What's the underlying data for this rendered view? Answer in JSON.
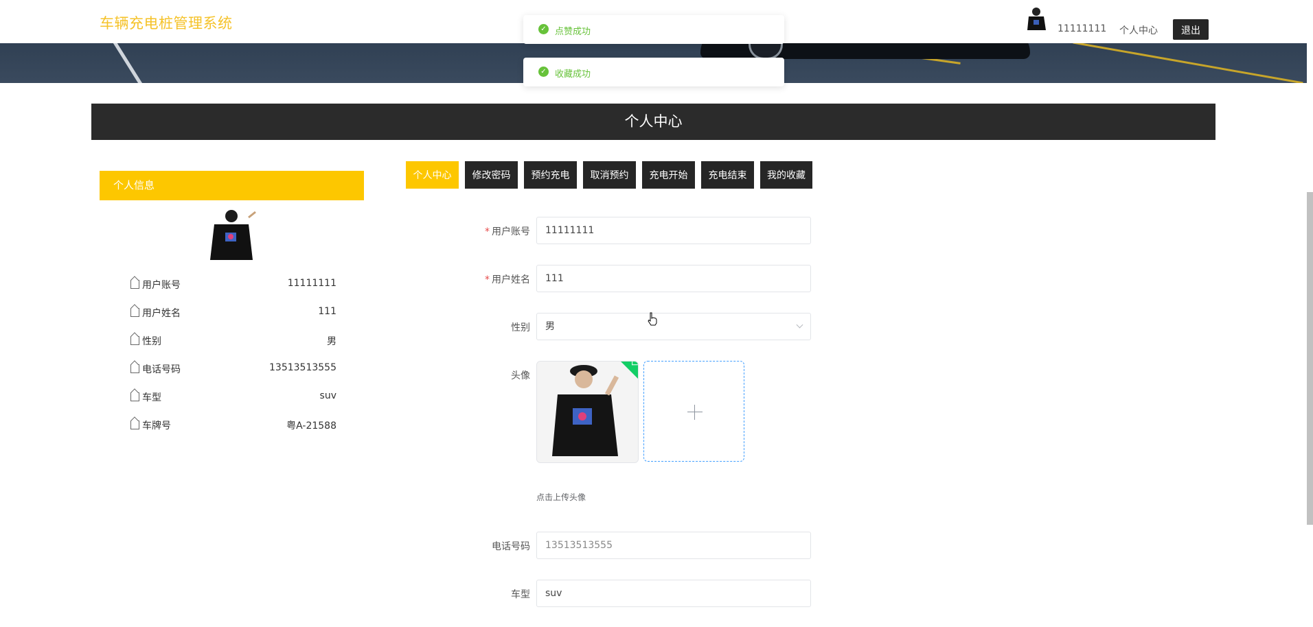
{
  "header": {
    "title": "车辆充电桩管理系统",
    "username": "11111111",
    "center_link": "个人中心",
    "logout_label": "退出"
  },
  "toasts": [
    {
      "text": "点赞成功",
      "color": "#67c23a"
    },
    {
      "text": "收藏成功",
      "color": "#67c23a"
    }
  ],
  "section_title": "个人中心",
  "info_card": {
    "title": "个人信息",
    "rows": [
      {
        "label": "用户账号",
        "value": "11111111"
      },
      {
        "label": "用户姓名",
        "value": "111"
      },
      {
        "label": "性别",
        "value": "男"
      },
      {
        "label": "电话号码",
        "value": "13513513555"
      },
      {
        "label": "车型",
        "value": "suv"
      },
      {
        "label": "车牌号",
        "value": "粤A-21588"
      }
    ]
  },
  "tabs": [
    {
      "label": "个人中心",
      "active": true
    },
    {
      "label": "修改密码",
      "active": false
    },
    {
      "label": "预约充电",
      "active": false
    },
    {
      "label": "取消预约",
      "active": false
    },
    {
      "label": "充电开始",
      "active": false
    },
    {
      "label": "充电结束",
      "active": false
    },
    {
      "label": "我的收藏",
      "active": false
    }
  ],
  "form": {
    "account": {
      "label": "用户账号",
      "required": "*",
      "value": "11111111"
    },
    "name": {
      "label": "用户姓名",
      "required": "*",
      "value": "111"
    },
    "gender": {
      "label": "性别",
      "value": "男"
    },
    "avatar": {
      "label": "头像",
      "tip": "点击上传头像"
    },
    "phone": {
      "label": "电话号码",
      "value": "13513513555"
    },
    "car_type": {
      "label": "车型",
      "value": "suv"
    }
  },
  "colors": {
    "accent": "#fdc700",
    "logo": "#f5c228",
    "dark": "#262626",
    "success": "#67c23a"
  }
}
